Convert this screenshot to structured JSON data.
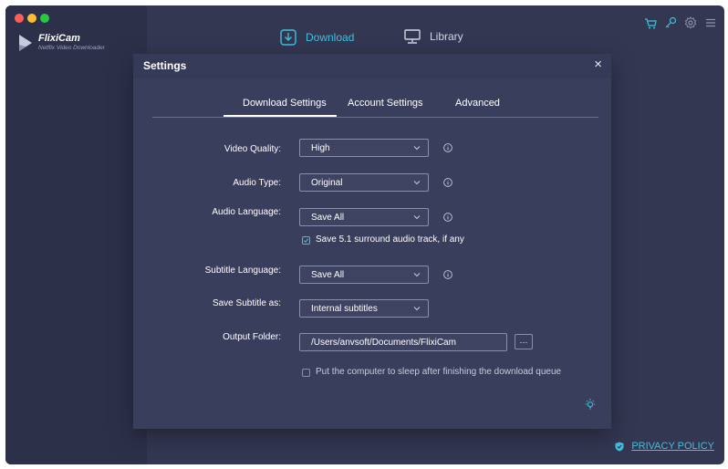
{
  "app": {
    "name": "FlixiCam",
    "subtitle": "Netflix Video Downloader"
  },
  "nav": {
    "download_label": "Download",
    "library_label": "Library"
  },
  "toolbar_icons": [
    "cart-icon",
    "key-icon",
    "gear-icon",
    "menu-icon"
  ],
  "footer": {
    "privacy_label": "PRIVACY POLICY"
  },
  "settings": {
    "title": "Settings",
    "close_glyph": "×",
    "tabs": [
      {
        "label": "Download Settings",
        "active": true
      },
      {
        "label": "Account Settings",
        "active": false
      },
      {
        "label": "Advanced",
        "active": false
      }
    ],
    "video_quality": {
      "label": "Video Quality:",
      "value": "High"
    },
    "audio_type": {
      "label": "Audio Type:",
      "value": "Original"
    },
    "audio_language": {
      "label": "Audio Language:",
      "value": "Save All"
    },
    "surround": {
      "label": "Save 5.1 surround audio track, if any",
      "checked": true
    },
    "subtitle_language": {
      "label": "Subtitle Language:",
      "value": "Save All"
    },
    "save_subtitle_as": {
      "label": "Save Subtitle as:",
      "value": "Internal subtitles"
    },
    "output_folder": {
      "label": "Output Folder:",
      "value": "/Users/anvsoft/Documents/FlixiCam",
      "browse_label": "···"
    },
    "sleep": {
      "label": "Put the computer to sleep after finishing the download queue",
      "checked": false
    }
  },
  "colors": {
    "accent": "#3ec2dd",
    "window_bg": "#343752",
    "modal_bg": "#3a3e5d"
  }
}
